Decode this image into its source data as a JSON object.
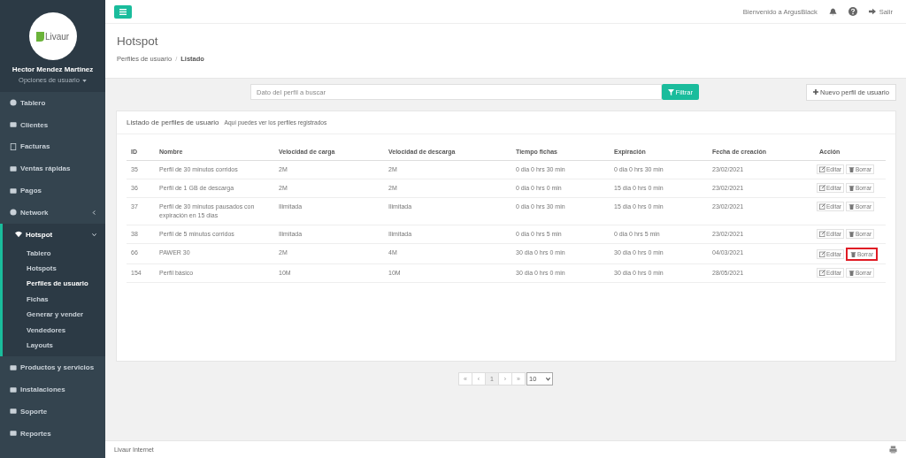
{
  "sidebar": {
    "logo": "Livaur",
    "user_name": "Hector Mendez Martinez",
    "user_options": "Opciones de usuario",
    "items": [
      {
        "label": "Tablero",
        "expanded": false,
        "has_children": false
      },
      {
        "label": "Clientes",
        "expanded": false,
        "has_children": false
      },
      {
        "label": "Facturas",
        "expanded": false,
        "has_children": false
      },
      {
        "label": "Ventas rápidas",
        "expanded": false,
        "has_children": false
      },
      {
        "label": "Pagos",
        "expanded": false,
        "has_children": false
      },
      {
        "label": "Network",
        "expanded": false,
        "has_children": true
      },
      {
        "label": "Hotspot",
        "expanded": true,
        "has_children": true,
        "children": [
          {
            "label": "Tablero",
            "selected": false
          },
          {
            "label": "Hotspots",
            "selected": false
          },
          {
            "label": "Perfiles de usuario",
            "selected": true
          },
          {
            "label": "Fichas",
            "selected": false
          },
          {
            "label": "Generar y vender",
            "selected": false
          },
          {
            "label": "Vendedores",
            "selected": false
          },
          {
            "label": "Layouts",
            "selected": false
          }
        ]
      },
      {
        "label": "Productos y servicios",
        "expanded": false,
        "has_children": false
      },
      {
        "label": "Instalaciones",
        "expanded": false,
        "has_children": false
      },
      {
        "label": "Soporte",
        "expanded": false,
        "has_children": false
      },
      {
        "label": "Reportes",
        "expanded": false,
        "has_children": false
      }
    ]
  },
  "topbar": {
    "welcome": "Bienvenido a ArgusBlack",
    "logout": "Salir"
  },
  "page": {
    "title": "Hotspot",
    "breadcrumb": [
      "Perfiles de usuario",
      "Listado"
    ],
    "breadcrumb_separator": "/"
  },
  "search": {
    "placeholder": "Dato del perfil a buscar",
    "button": "Filtrar"
  },
  "new_button": "Nuevo perfil de usuario",
  "panel": {
    "title": "Listado de perfiles de usuario",
    "subtitle": "Aquí puedes ver los perfiles registrados"
  },
  "table": {
    "columns": [
      "ID",
      "Nombre",
      "Velocidad de carga",
      "Velocidad de descarga",
      "Tiempo fichas",
      "Expiración",
      "Fecha de creación",
      "Acción"
    ],
    "rows": [
      {
        "cells": [
          "35",
          "Perfil de 30 minutos corridos",
          "2M",
          "2M",
          "0 dia 0 hrs 30 min",
          "0 dia 0 hrs 30 min",
          "23/02/2021"
        ],
        "edit": "Editar",
        "delete": "Borrar",
        "highlighted": false
      },
      {
        "cells": [
          "36",
          "Perfil de 1 GB de descarga",
          "2M",
          "2M",
          "0 dia 0 hrs 0 min",
          "15 dia 0 hrs 0 min",
          "23/02/2021"
        ],
        "edit": "Editar",
        "delete": "Borrar",
        "highlighted": false
      },
      {
        "cells": [
          "37",
          "Perfil de 30 minutos pausados con expiración en 15 dias",
          "Ilimitada",
          "Ilimitada",
          "0 dia 0 hrs 30 min",
          "15 dia 0 hrs 0 min",
          "23/02/2021"
        ],
        "edit": "Editar",
        "delete": "Borrar",
        "highlighted": false
      },
      {
        "cells": [
          "38",
          "Perfil de 5 minutos corridos",
          "Ilimitada",
          "Ilimitada",
          "0 dia 0 hrs 5 min",
          "0 dia 0 hrs 5 min",
          "23/02/2021"
        ],
        "edit": "Editar",
        "delete": "Borrar",
        "highlighted": false
      },
      {
        "cells": [
          "66",
          "PAWER 30",
          "2M",
          "4M",
          "30 dia 0 hrs 0 min",
          "30 dia 0 hrs 0 min",
          "04/03/2021"
        ],
        "edit": "Editar",
        "delete": "Borrar",
        "highlighted": true
      },
      {
        "cells": [
          "154",
          "Perfil básico",
          "10M",
          "10M",
          "30 dia 0 hrs 0 min",
          "30 dia 0 hrs 0 min",
          "28/05/2021"
        ],
        "edit": "Editar",
        "delete": "Borrar",
        "highlighted": false
      }
    ]
  },
  "pagination": {
    "first": "«",
    "prev": "‹",
    "pages": [
      {
        "label": "1",
        "selected": true
      }
    ],
    "next": "›",
    "last": "»",
    "page_size": "10"
  },
  "footer": {
    "text": "Livaur Internet"
  }
}
